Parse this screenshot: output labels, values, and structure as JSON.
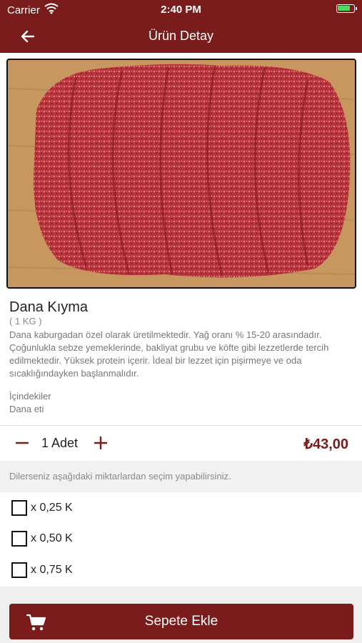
{
  "status_bar": {
    "carrier": "Carrier",
    "time": "2:40 PM",
    "wifi_icon": "wifi-icon",
    "battery_icon": "battery-charging-icon"
  },
  "nav": {
    "title": "Ürün Detay",
    "back_icon": "arrow-left-icon"
  },
  "product": {
    "image_icon": "ground-beef-photo",
    "name": "Dana Kıyma",
    "unit": "( 1 KG )",
    "description": "Dana kaburgadan özel olarak üretilmektedir. Yağ oranı % 15-20 arasındadır. Çoğunlukla sebze yemeklerinde, bakliyat grubu ve köfte gibi lezzetlerde tercih edilmektedir. Yüksek protein içerir. İdeal bir lezzet için pişirmeye ve oda sıcaklığındayken başlanmalıdır.",
    "ingredients_label": "İçindekiler",
    "ingredients_value": "Dana eti"
  },
  "quantity": {
    "label": "1 Adet",
    "minus_icon": "minus-icon",
    "plus_icon": "plus-icon"
  },
  "price": "₺43,00",
  "options": {
    "hint": "Dilerseniz aşağıdaki miktarlardan seçim yapabilirsiniz.",
    "items": [
      {
        "label": "x 0,25 K",
        "checked": false
      },
      {
        "label": "x 0,50 K",
        "checked": false
      },
      {
        "label": "x 0,75 K",
        "checked": false
      }
    ]
  },
  "cart_button": {
    "label": "Sepete Ekle",
    "icon": "cart-icon"
  },
  "colors": {
    "brand": "#7a1c1c",
    "accent_green": "#4cd964"
  }
}
